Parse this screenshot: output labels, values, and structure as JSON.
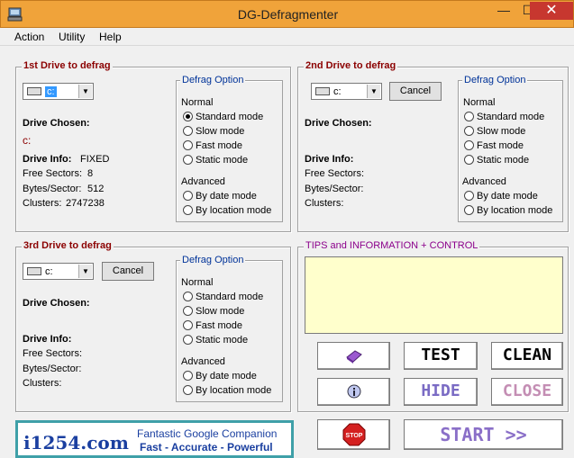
{
  "window": {
    "title": "DG-Defragmenter",
    "minimize": "—",
    "maximize": "☐",
    "close": "✕"
  },
  "menu": [
    "Action",
    "Utility",
    "Help"
  ],
  "drives": [
    {
      "title": "1st Drive to defrag",
      "combo_value": "c:",
      "has_cancel": false,
      "drive_chosen_label": "Drive Chosen:",
      "drive_chosen_value": "c:",
      "drive_info_label": "Drive Info:",
      "drive_info_value": "FIXED",
      "free_sectors_label": "Free Sectors:",
      "free_sectors_value": "8",
      "bytes_sector_label": "Bytes/Sector:",
      "bytes_sector_value": "512",
      "clusters_label": "Clusters:",
      "clusters_value": "2747238"
    },
    {
      "title": "2nd Drive to defrag",
      "combo_value": "c:",
      "cancel_label": "Cancel",
      "drive_chosen_label": "Drive Chosen:",
      "drive_info_label": "Drive Info:",
      "free_sectors_label": "Free Sectors:",
      "bytes_sector_label": "Bytes/Sector:",
      "clusters_label": "Clusters:"
    },
    {
      "title": "3rd Drive to defrag",
      "combo_value": "c:",
      "cancel_label": "Cancel",
      "drive_chosen_label": "Drive Chosen:",
      "drive_info_label": "Drive Info:",
      "free_sectors_label": "Free Sectors:",
      "bytes_sector_label": "Bytes/Sector:",
      "clusters_label": "Clusters:"
    }
  ],
  "defrag_option": {
    "title": "Defrag Option",
    "normal_label": "Normal",
    "normal_modes": [
      "Standard mode",
      "Slow mode",
      "Fast mode",
      "Static mode"
    ],
    "advanced_label": "Advanced",
    "advanced_modes": [
      "By date mode",
      "By location mode"
    ]
  },
  "tips": {
    "title": "TIPS and INFORMATION + CONTROL"
  },
  "buttons": {
    "test": "TEST",
    "clean": "CLEAN",
    "hide": "HIDE",
    "close": "CLOSE",
    "start": "START >>",
    "stop": "STOP"
  },
  "banner": {
    "logo": "i1254.com",
    "line1": "Fantastic Google Companion",
    "line2_a": "Fast",
    "line2_b": "Accurate",
    "line2_c": "Powerful",
    "sep": "-"
  },
  "colors": {
    "titlebar": "#f0a33a",
    "group_title": "#8b0000",
    "sub_title": "#003399",
    "tips_bg": "#ffffcc",
    "hide": "#7a6bc4",
    "close": "#c48eb4",
    "start": "#8a6fc8",
    "stop": "#d42020"
  }
}
